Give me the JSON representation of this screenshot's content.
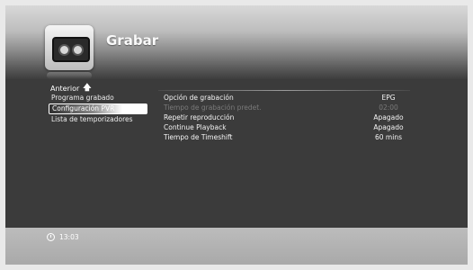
{
  "header": {
    "title": "Grabar",
    "icon": "recorder-tape-icon"
  },
  "nav": {
    "back_label": "Anterior",
    "back_icon": "arrow-up-icon"
  },
  "menu": {
    "items": [
      {
        "label": "Programa grabado"
      },
      {
        "label": "Configuración PVR",
        "selected": true
      },
      {
        "label": "Lista de temporizadores"
      }
    ]
  },
  "settings": {
    "rows": [
      {
        "label": "Opción de grabación",
        "value": "EPG",
        "enabled": true
      },
      {
        "label": "Tiempo de grabación predet.",
        "value": "02:00",
        "enabled": false
      },
      {
        "label": "Repetir reproducción",
        "value": "Apagado",
        "enabled": true
      },
      {
        "label": "Continue Playback",
        "value": "Apagado",
        "enabled": true
      },
      {
        "label": "Tiempo de Timeshift",
        "value": "60 mins",
        "enabled": true
      }
    ]
  },
  "status": {
    "clock_icon": "alarm-clock-icon",
    "time": "13:03"
  }
}
